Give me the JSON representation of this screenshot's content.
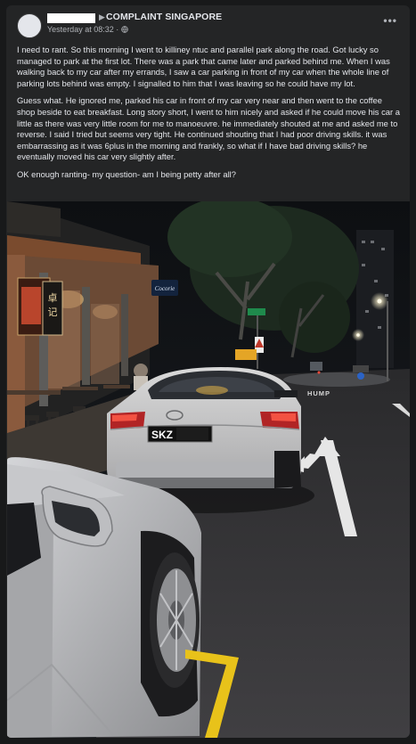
{
  "post": {
    "group_name": "COMPLAINT SINGAPORE",
    "timestamp": "Yesterday at 08:32 ·",
    "privacy_icon": "globe-icon",
    "more_icon": "more-horizontal-icon",
    "paragraphs": [
      "I need to rant. So this morning I went to killiney ntuc and parallel park along the road. Got lucky so managed to park at the first lot. There was a park that came later and parked behind me. When I was walking back to my car after my errands, I saw a car parking in front of my car when the whole line of parking lots behind was empty. I signalled to him that I was leaving so he could have my lot.",
      "Guess what. He ignored me, parked his car in front of my car very near and then went to the coffee shop beside to eat breakfast. Long story short, I went to him nicely and asked if he could move his car a little as there was very little room for me to manoeuvre. he immediately shouted at me and asked me to reverse. I said I tried but seems very tight. He continued shouting that I had poor driving skills. it was embarrassing as it was 6plus in the morning and frankly, so what if I have bad driving skills? he eventually moved his car very slightly after.",
      "OK enough ranting- my question- am I being petty after all?"
    ]
  },
  "photo": {
    "plate": "SKZ",
    "road_text": "HUMP",
    "shop_sign": "Cocorie",
    "colors": {
      "car_silver": "#c9c9c9",
      "lot_line_yellow": "#e8c21a",
      "road": "#3a3a3c"
    }
  }
}
